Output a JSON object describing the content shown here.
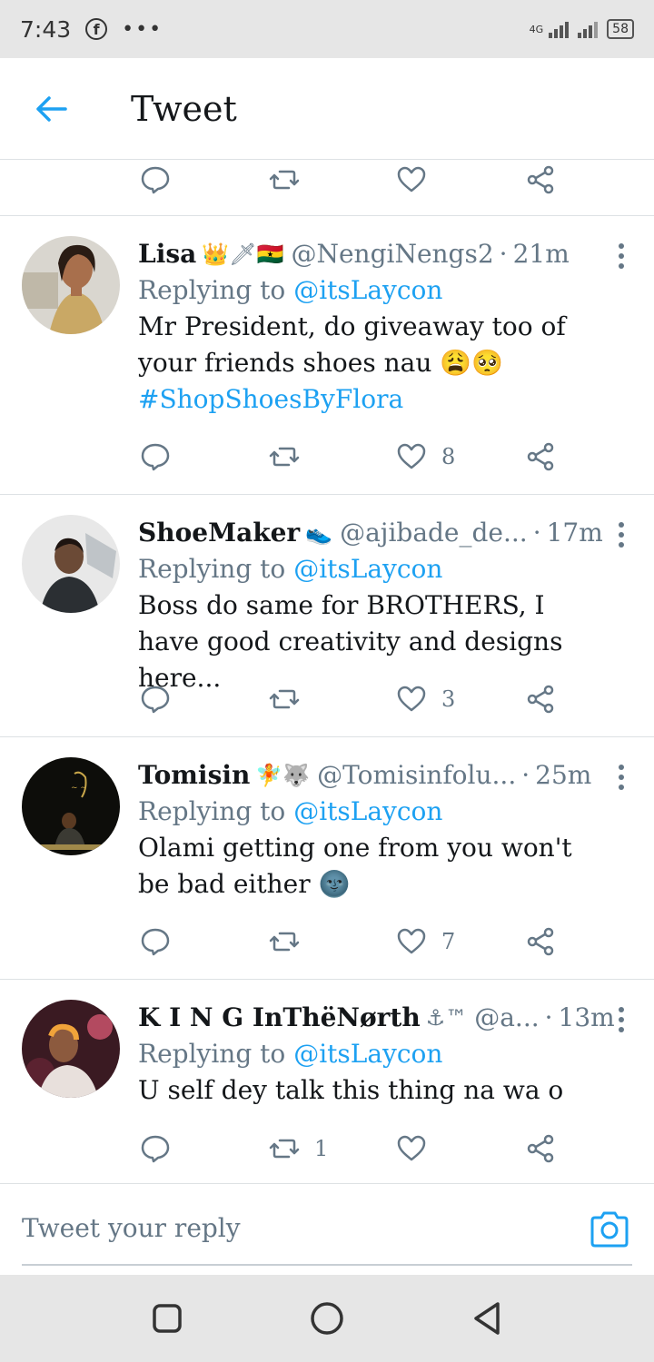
{
  "status_bar": {
    "time": "7:43",
    "network": "4G",
    "battery": "58"
  },
  "header": {
    "title": "Tweet"
  },
  "replies": [
    {
      "name": "Lisa",
      "emojis": "👑🗡🇬🇭",
      "handle": "@NengiNengs2",
      "time": "21m",
      "replying_label": "Replying to",
      "replying_to": "@itsLaycon",
      "text": "Mr President, do giveaway too of your friends shoes nau 😩🥺",
      "hashtag": "#ShopShoesByFlora",
      "like_count": "8",
      "retweet_count": ""
    },
    {
      "name": "ShoeMaker",
      "emojis": "👟",
      "handle": "@ajibade_de...",
      "time": "17m",
      "replying_label": "Replying to",
      "replying_to": "@itsLaycon",
      "text": "Boss do same for BROTHERS, I have good creativity and designs here...",
      "hashtag": "",
      "like_count": "3",
      "retweet_count": ""
    },
    {
      "name": "Tomisin",
      "emojis": "🧚🐺",
      "handle": "@Tomisinfolu...",
      "time": "25m",
      "replying_label": "Replying to",
      "replying_to": "@itsLaycon",
      "text": "Olami getting one from you won't be bad either 🌚",
      "hashtag": "",
      "like_count": "7",
      "retweet_count": ""
    },
    {
      "name": "K I N G InThëNørth",
      "emojis": "⚓™",
      "handle": "@a...",
      "time": "13m",
      "replying_label": "Replying to",
      "replying_to": "@itsLaycon",
      "text": "U self dey talk this thing na wa o",
      "hashtag": "",
      "like_count": "",
      "retweet_count": "1"
    }
  ],
  "reply_bar": {
    "placeholder": "Tweet your reply"
  },
  "icons": {
    "back": "arrow-left-icon",
    "reply": "comment-icon",
    "retweet": "retweet-icon",
    "like": "heart-icon",
    "share": "share-icon",
    "more": "more-vertical-icon",
    "camera": "camera-icon"
  },
  "colors": {
    "accent": "#1da1f2",
    "muted": "#657786",
    "text": "#14171a"
  }
}
